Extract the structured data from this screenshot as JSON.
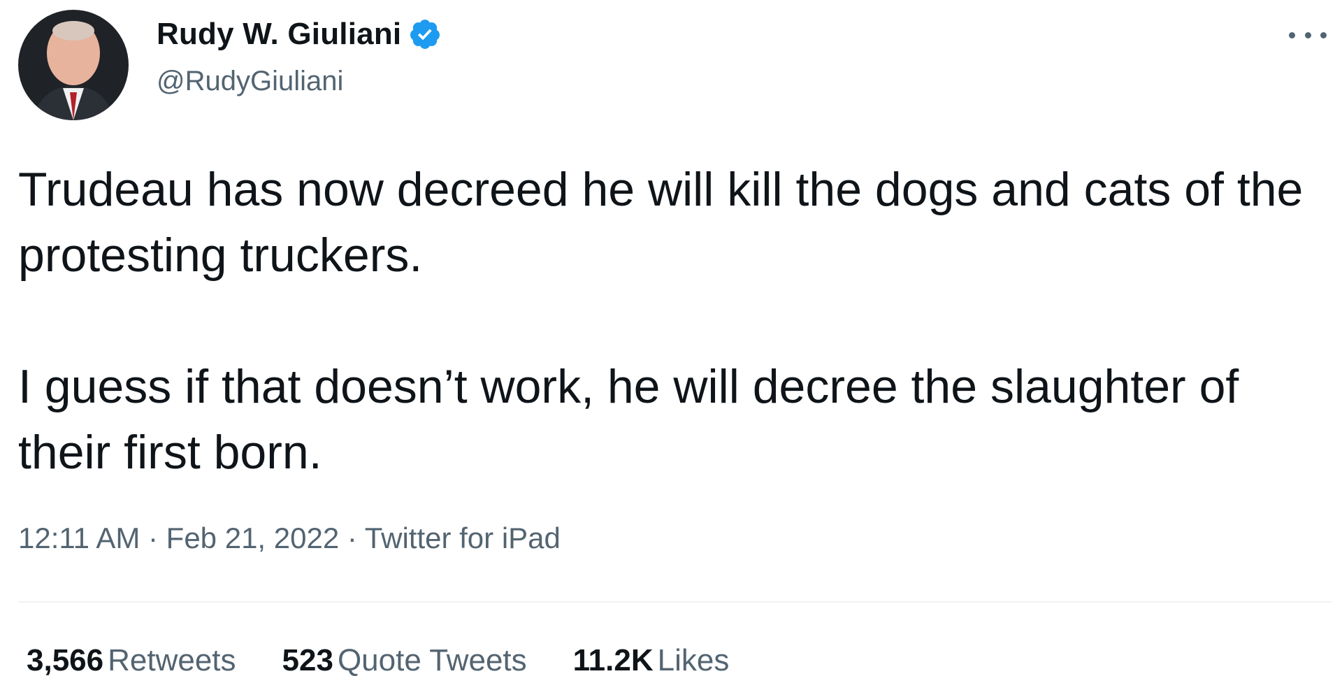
{
  "author": {
    "display_name": "Rudy W. Giuliani",
    "handle": "@RudyGiuliani",
    "verified": true,
    "avatar_icon": "profile-photo"
  },
  "tweet": {
    "paragraphs": [
      "Trudeau has now decreed he will kill the dogs and cats of the protesting truckers.",
      "I guess if that doesn’t work, he will decree the slaughter of their first born."
    ],
    "time": "12:11 AM",
    "date": "Feb 21, 2022",
    "separator": " · ",
    "source": "Twitter for iPad"
  },
  "stats": {
    "retweets": {
      "count": "3,566",
      "label": "Retweets"
    },
    "quote_tweets": {
      "count": "523",
      "label": "Quote Tweets"
    },
    "likes": {
      "count": "11.2K",
      "label": "Likes"
    }
  },
  "colors": {
    "text_primary": "#0f1419",
    "text_secondary": "#536471",
    "verified_blue": "#1d9bf0",
    "divider": "#eff3f4"
  },
  "icons": {
    "verified": "verified-badge-icon",
    "more": "more-horizontal-icon"
  }
}
